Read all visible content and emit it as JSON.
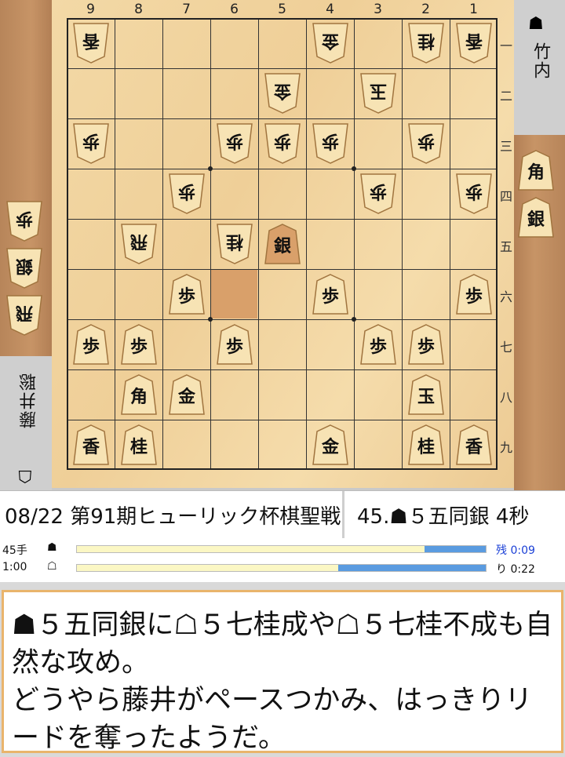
{
  "board": {
    "columns": [
      "9",
      "8",
      "7",
      "6",
      "5",
      "4",
      "3",
      "2",
      "1"
    ],
    "rows": [
      "一",
      "二",
      "三",
      "四",
      "五",
      "六",
      "七",
      "八",
      "九"
    ],
    "pieces": [
      {
        "label": "香",
        "side": "gote",
        "col": 9,
        "row": 1
      },
      {
        "label": "金",
        "side": "gote",
        "col": 4,
        "row": 1
      },
      {
        "label": "桂",
        "side": "gote",
        "col": 2,
        "row": 1
      },
      {
        "label": "香",
        "side": "gote",
        "col": 1,
        "row": 1
      },
      {
        "label": "金",
        "side": "gote",
        "col": 5,
        "row": 2
      },
      {
        "label": "玉",
        "side": "gote",
        "col": 3,
        "row": 2
      },
      {
        "label": "歩",
        "side": "gote",
        "col": 9,
        "row": 3
      },
      {
        "label": "歩",
        "side": "gote",
        "col": 6,
        "row": 3
      },
      {
        "label": "歩",
        "side": "gote",
        "col": 5,
        "row": 3
      },
      {
        "label": "歩",
        "side": "gote",
        "col": 4,
        "row": 3
      },
      {
        "label": "歩",
        "side": "gote",
        "col": 2,
        "row": 3
      },
      {
        "label": "歩",
        "side": "gote",
        "col": 7,
        "row": 4
      },
      {
        "label": "歩",
        "side": "gote",
        "col": 3,
        "row": 4
      },
      {
        "label": "歩",
        "side": "gote",
        "col": 1,
        "row": 4
      },
      {
        "label": "飛",
        "side": "gote",
        "col": 8,
        "row": 5
      },
      {
        "label": "桂",
        "side": "gote",
        "col": 6,
        "row": 5
      },
      {
        "label": "銀",
        "side": "sente",
        "col": 5,
        "row": 5,
        "last_move": true
      },
      {
        "label": "歩",
        "side": "sente",
        "col": 7,
        "row": 6
      },
      {
        "label": "歩",
        "side": "sente",
        "col": 4,
        "row": 6
      },
      {
        "label": "歩",
        "side": "sente",
        "col": 1,
        "row": 6
      },
      {
        "label": "歩",
        "side": "sente",
        "col": 9,
        "row": 7
      },
      {
        "label": "歩",
        "side": "sente",
        "col": 8,
        "row": 7
      },
      {
        "label": "歩",
        "side": "sente",
        "col": 6,
        "row": 7
      },
      {
        "label": "歩",
        "side": "sente",
        "col": 3,
        "row": 7
      },
      {
        "label": "歩",
        "side": "sente",
        "col": 2,
        "row": 7
      },
      {
        "label": "角",
        "side": "sente",
        "col": 8,
        "row": 8
      },
      {
        "label": "金",
        "side": "sente",
        "col": 7,
        "row": 8
      },
      {
        "label": "玉",
        "side": "sente",
        "col": 2,
        "row": 8
      },
      {
        "label": "香",
        "side": "sente",
        "col": 9,
        "row": 9
      },
      {
        "label": "桂",
        "side": "sente",
        "col": 8,
        "row": 9
      },
      {
        "label": "金",
        "side": "sente",
        "col": 4,
        "row": 9
      },
      {
        "label": "桂",
        "side": "sente",
        "col": 2,
        "row": 9
      },
      {
        "label": "香",
        "side": "sente",
        "col": 1,
        "row": 9
      }
    ],
    "highlight_square": {
      "col": 6,
      "row": 6
    }
  },
  "sente_player": {
    "name": "竹内",
    "icon": "black-turn-icon",
    "symbol": "☗"
  },
  "gote_player": {
    "name": "藤井聡",
    "icon": "white-turn-icon",
    "symbol": "☖"
  },
  "sente_hand": [
    "角",
    "銀"
  ],
  "gote_hand": [
    "歩",
    "銀",
    "飛"
  ],
  "info": {
    "event": "08/22 第91期ヒューリック杯棋聖戦",
    "move": "45.☗５五同銀 4秒"
  },
  "timer": {
    "moves_label": "45手",
    "time_label": "1:00",
    "sente_symbol": "☗",
    "gote_symbol": "☖",
    "sente_used_fraction": 0.85,
    "gote_used_fraction": 0.64,
    "remain_label_1": "残 0:09",
    "remain_label_2": "り 0:22",
    "bar_color": "#5a9be0",
    "used_color": "#fbf7c4"
  },
  "comment": "☗５五同銀に☖５七桂成や☖５七桂不成も自然な攻め。\nどうやら藤井がペースつかみ、はっきりリードを奪ったようだ。",
  "colors": {
    "board": "#efcf98",
    "wood": "#c79466",
    "accent_border": "#e9b46c"
  }
}
